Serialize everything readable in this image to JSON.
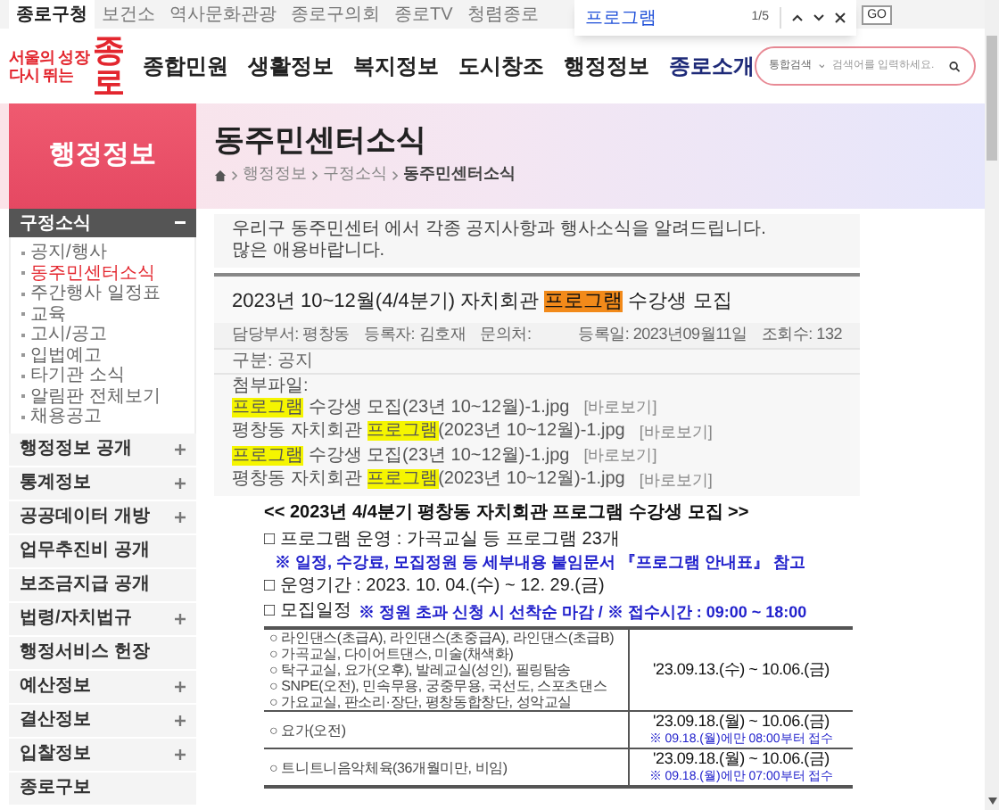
{
  "top_links": [
    {
      "label": "종로구청",
      "selected": true
    },
    {
      "label": "보건소",
      "selected": false
    },
    {
      "label": "역사문화관광",
      "selected": false
    },
    {
      "label": "종로구의회",
      "selected": false
    },
    {
      "label": "종로TV",
      "selected": false
    },
    {
      "label": "청렴종로",
      "selected": false
    }
  ],
  "go_button": "GO",
  "find_bar": {
    "query": "프로그램",
    "count": "1/5"
  },
  "logo": {
    "tagline_1": "서울의 성장",
    "tagline_2": "다시 뛰는",
    "name": "종로"
  },
  "nav": [
    {
      "label": "종합민원",
      "selected": false
    },
    {
      "label": "생활정보",
      "selected": false
    },
    {
      "label": "복지정보",
      "selected": false
    },
    {
      "label": "도시창조",
      "selected": false
    },
    {
      "label": "행정정보",
      "selected": false
    },
    {
      "label": "종로소개",
      "selected": true
    }
  ],
  "search": {
    "scope": "통합검색",
    "placeholder": "검색어를 입력하세요."
  },
  "sidebar": {
    "title": "행정정보",
    "sections": [
      {
        "label": "구정소식",
        "kind": "group",
        "expanded": true,
        "children": [
          {
            "label": "공지/행사",
            "selected": false
          },
          {
            "label": "동주민센터소식",
            "selected": true
          },
          {
            "label": "주간행사 일정표",
            "selected": false
          },
          {
            "label": "교육",
            "selected": false
          },
          {
            "label": "고시/공고",
            "selected": false
          },
          {
            "label": "입법예고",
            "selected": false
          },
          {
            "label": "타기관 소식",
            "selected": false
          },
          {
            "label": "알림판 전체보기",
            "selected": false
          },
          {
            "label": "채용공고",
            "selected": false
          }
        ]
      },
      {
        "label": "행정정보 공개",
        "kind": "group",
        "expanded": false
      },
      {
        "label": "통계정보",
        "kind": "group",
        "expanded": false
      },
      {
        "label": "공공데이터 개방",
        "kind": "group",
        "expanded": false
      },
      {
        "label": "업무추진비 공개",
        "kind": "link"
      },
      {
        "label": "보조금지급 공개",
        "kind": "link"
      },
      {
        "label": "법령/자치법규",
        "kind": "group",
        "expanded": false
      },
      {
        "label": "행정서비스 헌장",
        "kind": "link"
      },
      {
        "label": "예산정보",
        "kind": "group",
        "expanded": false
      },
      {
        "label": "결산정보",
        "kind": "group",
        "expanded": false
      },
      {
        "label": "입찰정보",
        "kind": "group",
        "expanded": false
      },
      {
        "label": "종로구보",
        "kind": "link"
      }
    ]
  },
  "page_title": "동주민센터소식",
  "breadcrumb": [
    "행정정보",
    "구정소식",
    "동주민센터소식"
  ],
  "intro": [
    "우리구 동주민센터 에서 각종 공지사항과 행사소식을 알려드립니다.",
    "많은 애용바랍니다."
  ],
  "post": {
    "title": [
      {
        "text": "2023년 10~12월(4/4분기) 자치회관 ",
        "highlighted": false,
        "current": false
      },
      {
        "text": "프로그램",
        "highlighted": true,
        "current": true
      },
      {
        "text": " 수강생 모집",
        "highlighted": false,
        "current": false
      }
    ],
    "meta_left": [
      "담당부서: 평창동",
      "등록자: 김호재",
      "문의처:"
    ],
    "meta_right": [
      "등록일: 2023년09월11일",
      "조회수: 132"
    ],
    "category": "구분: 공지",
    "attachments_label": "첨부파일:",
    "attachments": [
      {
        "name": [
          {
            "text": "프로그램",
            "highlighted": true,
            "current": false
          },
          {
            "text": " 수강생 모집(23년 10~12월)-1.jpg",
            "highlighted": false,
            "current": false
          }
        ],
        "view": "[바로보기]"
      },
      {
        "name": [
          {
            "text": "평창동 자치회관 ",
            "highlighted": false,
            "current": false
          },
          {
            "text": "프로그램",
            "highlighted": true,
            "current": false
          },
          {
            "text": "(2023년 10~12월)-1.jpg",
            "highlighted": false,
            "current": false
          }
        ],
        "view": "[바로보기]"
      },
      {
        "name": [
          {
            "text": "프로그램",
            "highlighted": true,
            "current": false
          },
          {
            "text": " 수강생 모집(23년 10~12월)-1.jpg",
            "highlighted": false,
            "current": false
          }
        ],
        "view": "[바로보기]"
      },
      {
        "name": [
          {
            "text": "평창동 자치회관 ",
            "highlighted": false,
            "current": false
          },
          {
            "text": "프로그램",
            "highlighted": true,
            "current": false
          },
          {
            "text": "(2023년 10~12월)-1.jpg",
            "highlighted": false,
            "current": false
          }
        ],
        "view": "[바로보기]"
      }
    ]
  },
  "body": {
    "heading": "<< 2023년 4/4분기 평창동 자치회관 프로그램 수강생 모집 >>",
    "items": [
      {
        "label": "□ 프로그램 운영 : 가곡교실 등 프로그램 23개",
        "note": "※ 일정, 수강료, 모집정원 등 세부내용 붙임문서 『프로그램 안내표』 참고"
      },
      {
        "label": "□ 운영기간 : 2023. 10. 04.(수) ~ 12. 29.(금)"
      },
      {
        "label": "□ 모집일정",
        "inline_note": "※ 정원 초과 신청 시 선착순 마감 / ※ 접수시간 : 09:00 ~ 18:00"
      }
    ],
    "schedule": [
      {
        "programs": [
          "○ 라인댄스(초급A), 라인댄스(초중급A), 라인댄스(초급B)",
          "○ 가곡교실, 다이어트댄스, 미술(채색화)",
          "○ 탁구교실, 요가(오후), 발레교실(성인), 필링탐송",
          "○ SNPE(오전), 민속무용, 궁중무용, 국선도, 스포츠댄스",
          "○ 가요교실, 판소리·장단, 평창동합창단, 성악교실"
        ],
        "period": "'23.09.13.(수) ~ 10.06.(금)"
      },
      {
        "programs": [
          "○ 요가(오전)"
        ],
        "period": "'23.09.18.(월) ~ 10.06.(금)",
        "note": "※ 09.18.(월)에만 08:00부터 접수"
      },
      {
        "programs": [
          "○ 트니트니음악체육(36개월미만, 비임)"
        ],
        "period": "'23.09.18.(월) ~ 10.06.(금)",
        "note": "※ 09.18.(월)에만 07:00부터 접수"
      }
    ]
  }
}
